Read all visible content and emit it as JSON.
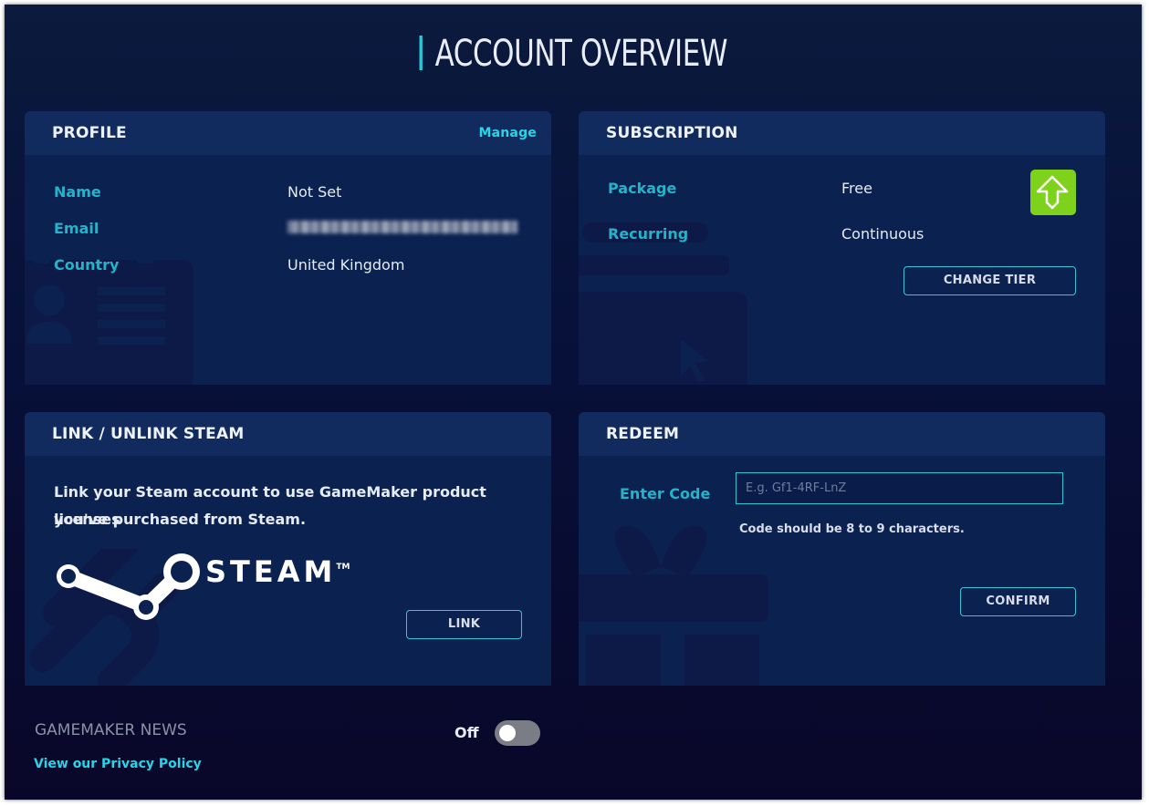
{
  "page_title": "ACCOUNT OVERVIEW",
  "profile": {
    "header": "PROFILE",
    "manage_link": "Manage",
    "name_label": "Name",
    "name_value": "Not Set",
    "email_label": "Email",
    "country_label": "Country",
    "country_value": "United Kingdom"
  },
  "subscription": {
    "header": "SUBSCRIPTION",
    "package_label": "Package",
    "package_value": "Free",
    "recurring_label": "Recurring",
    "recurring_value": "Continuous",
    "change_tier_label": "CHANGE TIER",
    "upgrade_icon": "upgrade-arrow-icon"
  },
  "steam": {
    "header": "LINK / UNLINK STEAM",
    "description_line1": "Link your Steam account to use GameMaker product licenses",
    "description_line2": "you've purchased from Steam.",
    "logo_text": "STEAM",
    "logo_tm": "TM",
    "link_label": "LINK"
  },
  "redeem": {
    "header": "REDEEM",
    "code_label": "Enter Code",
    "code_placeholder": "E.g. Gf1-4RF-LnZ",
    "code_value": "",
    "hint": "Code should be 8 to 9 characters.",
    "confirm_label": "CONFIRM"
  },
  "footer": {
    "news_label": "GAMEMAKER NEWS",
    "toggle_state": "Off",
    "privacy_link": "View our Privacy Policy"
  },
  "colors": {
    "accent": "#27c6d8",
    "label": "#24b3c9",
    "upgrade": "#7fd21b",
    "card": "#0b2150",
    "card_header": "#112b5e"
  }
}
